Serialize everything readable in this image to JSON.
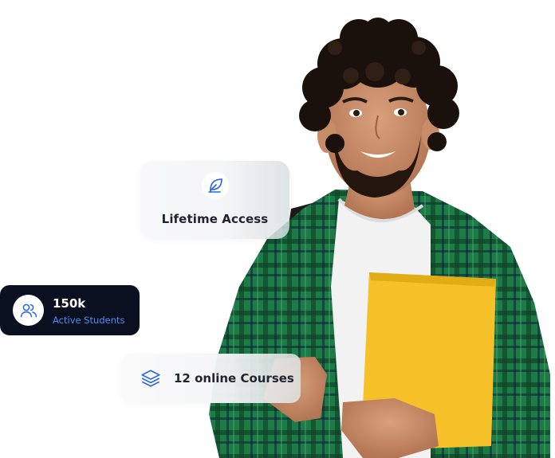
{
  "cards": {
    "lifetime": {
      "icon": "feather-icon",
      "label": "Lifetime Access"
    },
    "students": {
      "icon": "users-icon",
      "count": "150k",
      "subtitle": "Active Students"
    },
    "courses": {
      "icon": "layers-icon",
      "label": "12 online Courses"
    }
  },
  "colors": {
    "accent": "#2563eb",
    "dark_card": "#0b1020",
    "subtitle_blue": "#4f8df5",
    "shirt_green": "#1f7a47",
    "folder_yellow": "#f6c128"
  }
}
